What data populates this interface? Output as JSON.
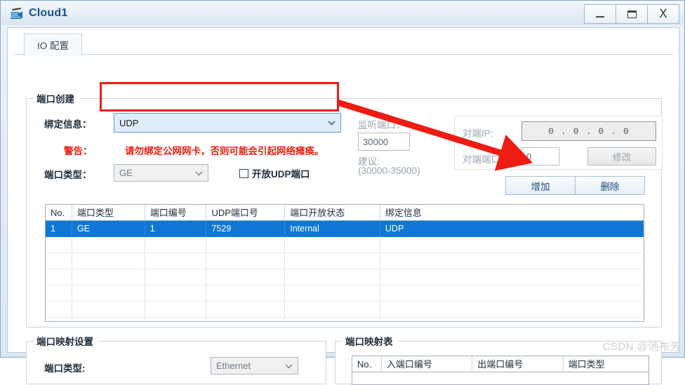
{
  "window": {
    "title": "Cloud1",
    "icon": "cloud-device-icon",
    "buttons": {
      "minimize": "minimize-icon",
      "maximize": "maximize-icon",
      "close": "X"
    }
  },
  "tabs": [
    {
      "label": "IO 配置",
      "active": true
    }
  ],
  "port_create": {
    "group_title": "端口创建",
    "bind_info_label": "绑定信息：",
    "bind_info_value": "UDP",
    "warning_label": "警告：",
    "warning_text": "请勿绑定公网网卡，否则可能会引起网络瘫痪。",
    "port_type_label": "端口类型：",
    "port_type_value": "GE",
    "open_udp_checkbox_label": "开放UDP端口",
    "open_udp_checked": false,
    "listen_port_label": "监听端口：",
    "listen_port_value": "30000",
    "suggest_label": "建议:",
    "suggest_range": "(30000-35000)",
    "peer_ip_label": "对端IP:",
    "peer_ip_octets": [
      "0",
      "0",
      "0",
      "0"
    ],
    "peer_port_label": "对端端口:",
    "peer_port_value": "0",
    "modify_button": "修改",
    "add_button": "增加",
    "delete_button": "删除",
    "table": {
      "columns": [
        "No.",
        "端口类型",
        "端口编号",
        "UDP端口号",
        "端口开放状态",
        "绑定信息"
      ],
      "rows": [
        {
          "selected": true,
          "cells": [
            "1",
            "GE",
            "1",
            "7529",
            "Internal",
            "UDP"
          ]
        },
        {
          "selected": false,
          "cells": [
            "",
            "",
            "",
            "",
            "",
            ""
          ]
        },
        {
          "selected": false,
          "cells": [
            "",
            "",
            "",
            "",
            "",
            ""
          ]
        },
        {
          "selected": false,
          "cells": [
            "",
            "",
            "",
            "",
            "",
            ""
          ]
        },
        {
          "selected": false,
          "cells": [
            "",
            "",
            "",
            "",
            "",
            ""
          ]
        },
        {
          "selected": false,
          "cells": [
            "",
            "",
            "",
            "",
            "",
            ""
          ]
        },
        {
          "selected": false,
          "cells": [
            "",
            "",
            "",
            "",
            "",
            ""
          ]
        }
      ]
    }
  },
  "map_settings": {
    "group_title": "端口映射设置",
    "port_type_label": "端口类型:",
    "port_type_value": "Ethernet"
  },
  "map_table": {
    "group_title": "端口映射表",
    "columns": [
      "No.",
      "入端口编号",
      "出端口编号",
      "端口类型"
    ]
  },
  "watermark": "CSDN @池布芳",
  "colors": {
    "annotation_red": "#ee1c12",
    "selection_blue": "#1077d4",
    "title_blue": "#12508f"
  }
}
